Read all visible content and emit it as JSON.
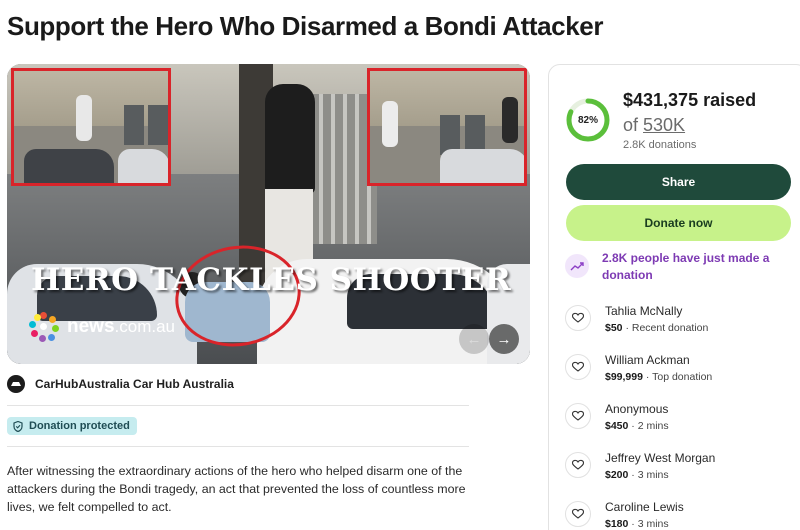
{
  "page": {
    "title": "Support the Hero Who Disarmed a Bondi Attacker"
  },
  "media": {
    "headline": "HERO TACKLES SHOOTER",
    "watermark_brand": "news",
    "watermark_domain": ".com.au",
    "prev_label": "←",
    "next_label": "→"
  },
  "organizer": {
    "name": "CarHubAustralia Car Hub Australia"
  },
  "badge": {
    "label": "Donation protected"
  },
  "story": {
    "text": "After witnessing the extraordinary actions of the hero who helped disarm one of the attackers during the Bondi tragedy, an act that prevented the loss of countless more lives, we felt compelled to act."
  },
  "fundraiser": {
    "percent_label": "82%",
    "progress": 0.82,
    "raised": "$431,375 raised",
    "goal_prefix": "of ",
    "goal": "530K",
    "donations": "2.8K donations",
    "share_label": "Share",
    "donate_label": "Donate now",
    "trend_text": "2.8K people have just made a donation"
  },
  "donors": [
    {
      "name": "Tahlia McNally",
      "amount": "$50",
      "note": " · Recent donation"
    },
    {
      "name": "William Ackman",
      "amount": "$99,999",
      "note": " · Top donation"
    },
    {
      "name": "Anonymous",
      "amount": "$450",
      "note": " · 2 mins"
    },
    {
      "name": "Jeffrey West Morgan",
      "amount": "$200",
      "note": " · 3 mins"
    },
    {
      "name": "Caroline Lewis",
      "amount": "$180",
      "note": " · 3 mins"
    }
  ],
  "colors": {
    "accent_dark_green": "#1f4a3b",
    "accent_lime": "#c7f28a",
    "progress_green": "#5bbf3b",
    "trend_purple": "#7d3ab3",
    "protected_bg": "#c6ecef"
  }
}
